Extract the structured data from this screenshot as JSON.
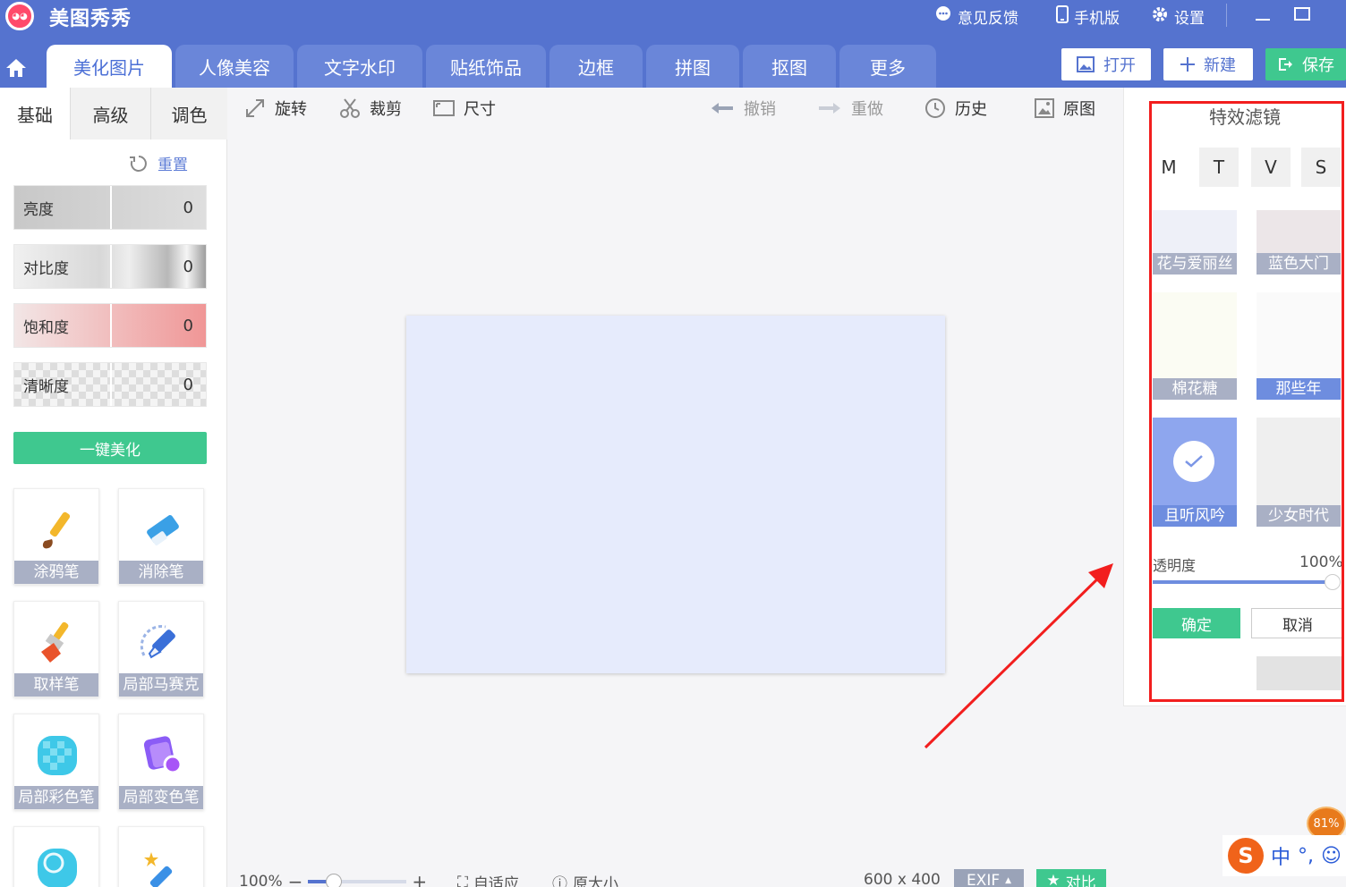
{
  "titlebar": {
    "app_title": "美图秀秀",
    "feedback": "意见反馈",
    "mobile": "手机版",
    "settings": "设置"
  },
  "menubar": {
    "tabs": [
      "美化图片",
      "人像美容",
      "文字水印",
      "贴纸饰品",
      "边框",
      "拼图",
      "抠图",
      "更多"
    ],
    "open": "打开",
    "new": "新建",
    "save": "保存"
  },
  "left_panel": {
    "subtabs": [
      "基础",
      "高级",
      "调色"
    ],
    "reset": "重置",
    "sliders": [
      {
        "label": "亮度",
        "value": "0"
      },
      {
        "label": "对比度",
        "value": "0"
      },
      {
        "label": "饱和度",
        "value": "0"
      },
      {
        "label": "清晰度",
        "value": "0"
      }
    ],
    "auto_beautify": "一键美化",
    "tools": [
      "涂鸦笔",
      "消除笔",
      "取样笔",
      "局部马赛克",
      "局部彩色笔",
      "局部变色笔"
    ]
  },
  "canvas_toolbar": {
    "rotate": "旋转",
    "crop": "裁剪",
    "size": "尺寸",
    "undo": "撤销",
    "redo": "重做",
    "history": "历史",
    "original": "原图"
  },
  "canvas_status": {
    "zoom": "100%",
    "fit": "自适应",
    "actual_size": "原大小",
    "dimensions": "600 x 400",
    "exif": "EXIF",
    "compare": "对比"
  },
  "right_panel": {
    "title": "特效滤镜",
    "letters": [
      "M",
      "T",
      "V",
      "S"
    ],
    "filters": [
      {
        "label": "花与爱丽丝",
        "selected": false
      },
      {
        "label": "蓝色大门",
        "selected": false
      },
      {
        "label": "棉花糖",
        "selected": false
      },
      {
        "label": "那些年",
        "selected": false
      },
      {
        "label": "且听风吟",
        "selected": true
      },
      {
        "label": "少女时代",
        "selected": false
      }
    ],
    "opacity_label": "透明度",
    "opacity_value": "100%",
    "ok": "确定",
    "cancel": "取消"
  },
  "tray": {
    "battery": "81%",
    "ime_lang": "中"
  },
  "colors": {
    "brand_blue": "#5573cf",
    "accent_green": "#3fc88f",
    "highlight_red": "#f21e1e"
  }
}
